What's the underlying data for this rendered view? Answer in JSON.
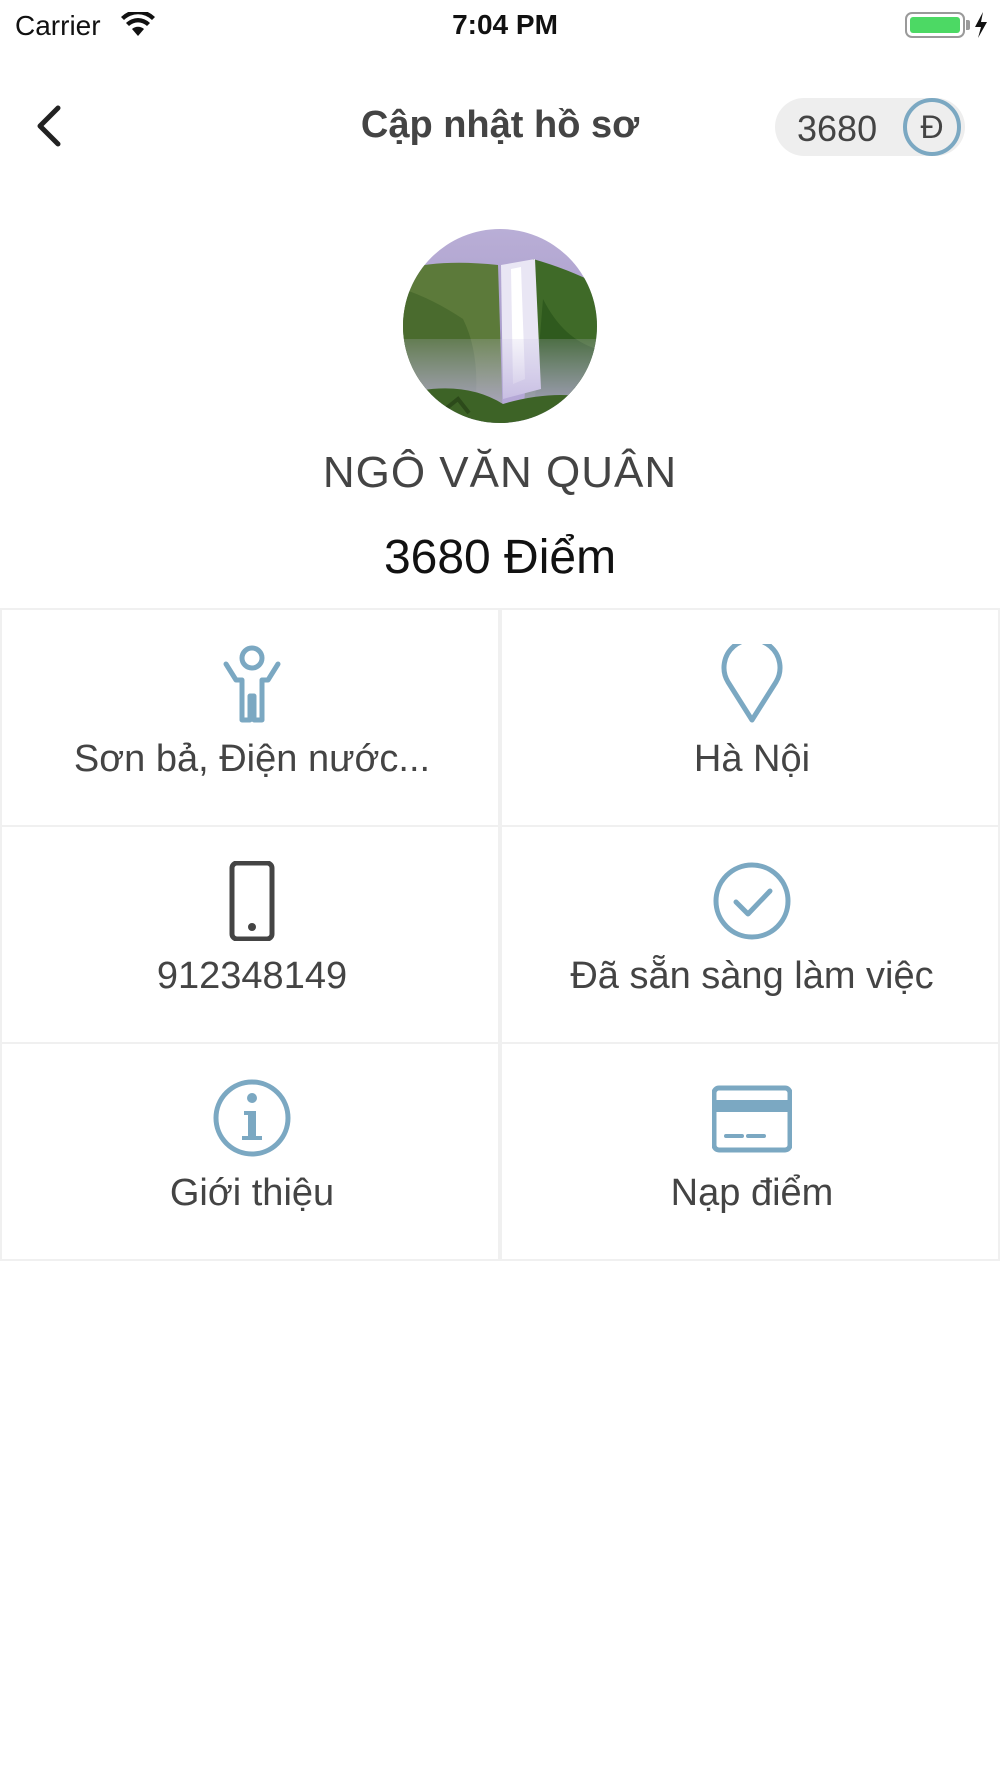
{
  "status_bar": {
    "carrier": "Carrier",
    "time": "7:04 PM",
    "battery_color": "#4cd964"
  },
  "nav": {
    "back_icon": "chevron-left-icon",
    "title": "Cập nhật hồ sơ",
    "points_value": "3680",
    "coin_symbol": "Đ"
  },
  "profile": {
    "avatar_image": "waterfall landscape",
    "name": "NGÔ VĂN QUÂN",
    "points_label": "3680 Điểm"
  },
  "grid": {
    "skills": {
      "icon": "person-icon",
      "label": "Sơn bả, Điện nước..."
    },
    "location": {
      "icon": "map-pin-icon",
      "label": "Hà Nội"
    },
    "phone": {
      "icon": "phone-icon",
      "label": "912348149"
    },
    "status": {
      "icon": "check-circle-icon",
      "label": "Đã sẵn sàng làm việc"
    },
    "about": {
      "icon": "info-icon",
      "label": "Giới thiệu"
    },
    "top_up": {
      "icon": "credit-card-icon",
      "label": "Nạp điểm"
    }
  },
  "colors": {
    "accent": "#7ba8c2",
    "text": "#444444",
    "divider": "#f0f0f0"
  }
}
